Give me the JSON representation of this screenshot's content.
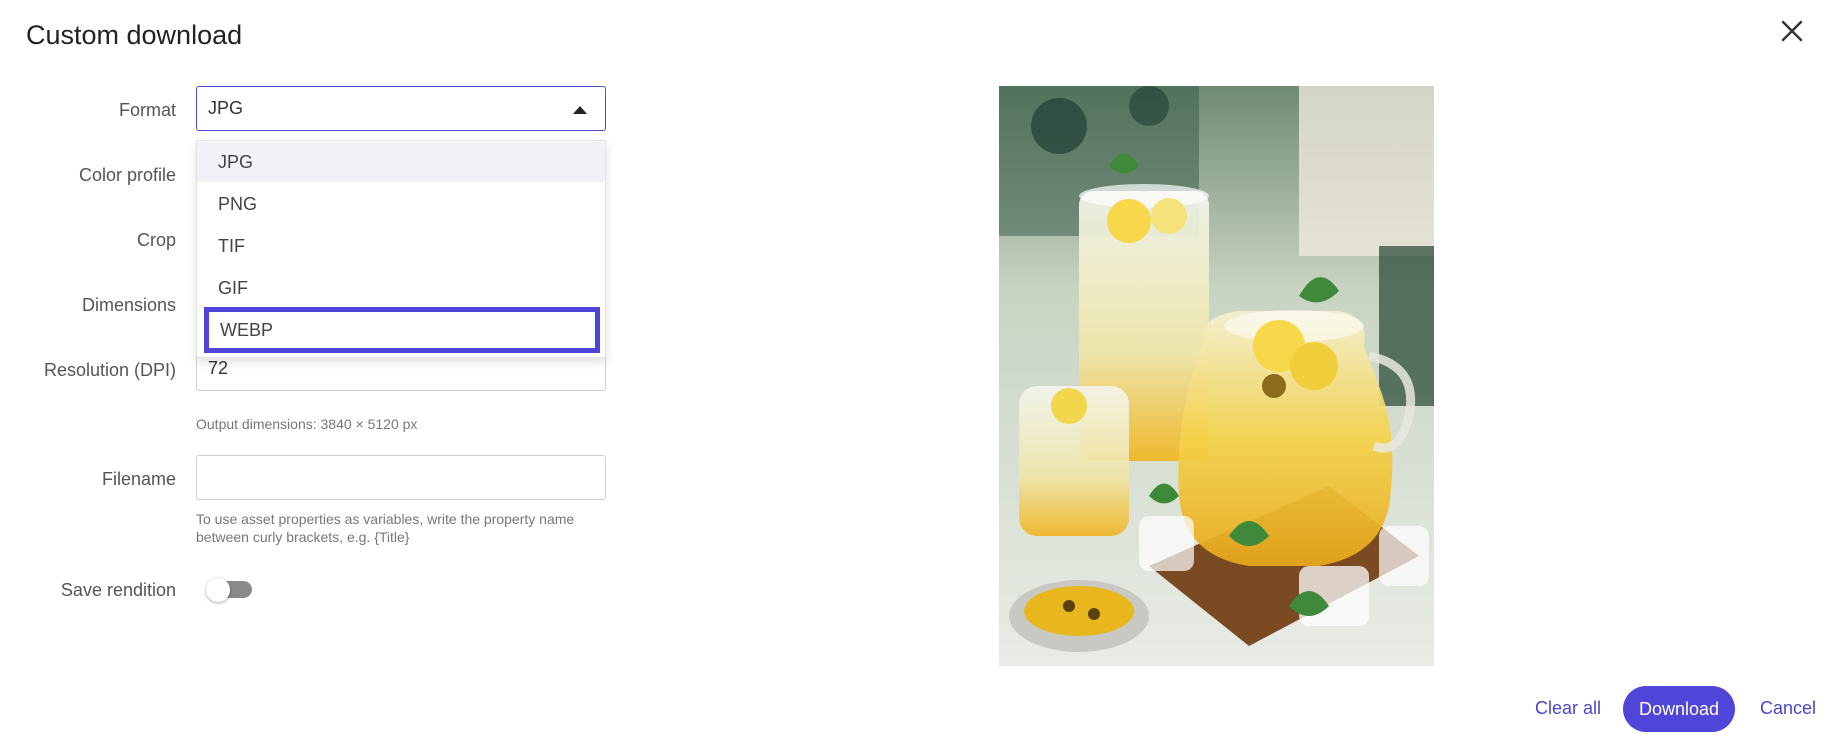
{
  "dialog": {
    "title": "Custom download"
  },
  "form": {
    "format": {
      "label": "Format",
      "value": "JPG"
    },
    "color_profile": {
      "label": "Color profile"
    },
    "crop": {
      "label": "Crop"
    },
    "dimensions": {
      "label": "Dimensions"
    },
    "resolution": {
      "label": "Resolution (DPI)",
      "value": "72"
    },
    "output_dimensions": "Output dimensions: 3840 × 5120 px",
    "filename": {
      "label": "Filename",
      "value": "",
      "hint": "To use asset properties as variables, write the property name between curly brackets, e.g. {Title}"
    },
    "save_rendition": {
      "label": "Save rendition",
      "on": false
    }
  },
  "format_options": [
    "JPG",
    "PNG",
    "TIF",
    "GIF",
    "WEBP"
  ],
  "dropdown_state": {
    "selected": "JPG",
    "highlighted": "WEBP"
  },
  "footer": {
    "clear_all": "Clear all",
    "download": "Download",
    "cancel": "Cancel"
  },
  "colors": {
    "accent": "#4f45d8",
    "link": "#4a46c9",
    "focus_border": "#4a4fd0"
  }
}
